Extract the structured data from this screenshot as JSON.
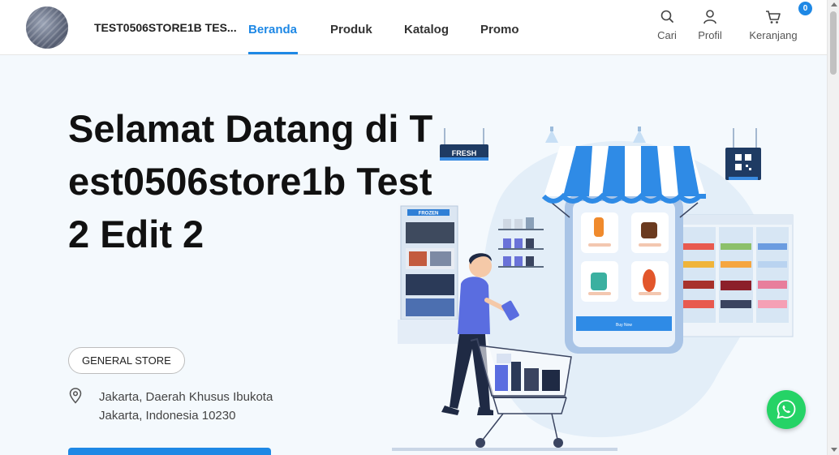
{
  "header": {
    "store_name": "TEST0506STORE1B TES...",
    "nav": [
      {
        "label": "Beranda",
        "active": true
      },
      {
        "label": "Produk",
        "active": false
      },
      {
        "label": "Katalog",
        "active": false
      },
      {
        "label": "Promo",
        "active": false
      }
    ],
    "actions": {
      "search_label": "Cari",
      "search_icon": "search-icon",
      "profile_label": "Profil",
      "profile_icon": "user-icon",
      "cart_label": "Keranjang",
      "cart_icon": "cart-icon",
      "cart_count": "0"
    },
    "accent_color": "#1e88e5"
  },
  "hero": {
    "title": "Selamat Datang di Test0506store1b Test 2 Edit 2",
    "category": "GENERAL STORE",
    "address_line1": "Jakarta, Daerah Khusus Ibukota",
    "address_line2": "Jakarta, Indonesia 10230",
    "location_icon": "map-pin-icon",
    "illustration": {
      "fresh_sign": "FRESH",
      "frozen_sign": "FROZEN",
      "buy_now": "Buy Now"
    }
  },
  "whatsapp": {
    "icon": "whatsapp-icon",
    "color": "#25d366"
  }
}
